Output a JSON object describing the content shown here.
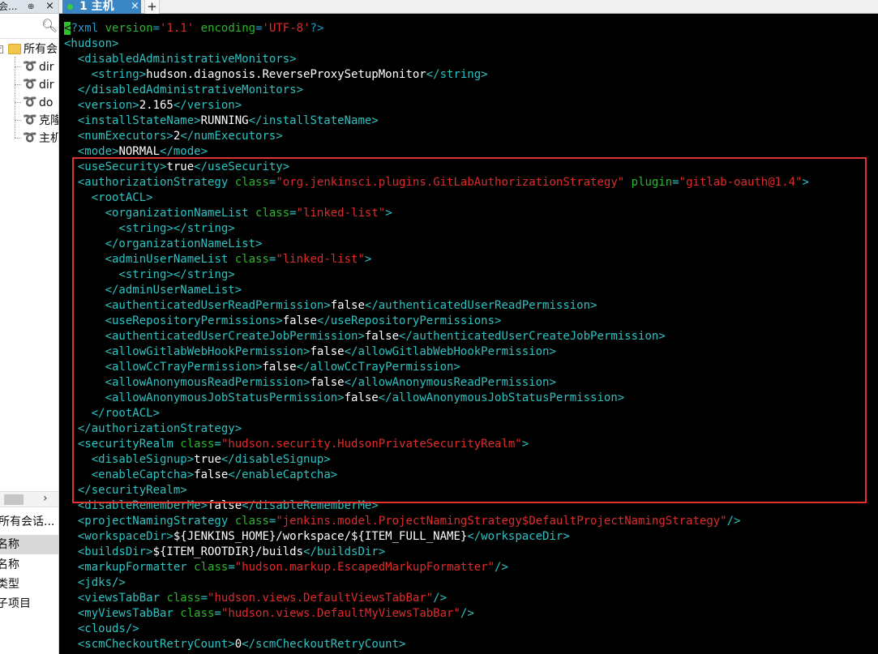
{
  "left_panel": {
    "title": "会...",
    "pin_glyph": "⊕",
    "close_glyph": "×",
    "root_label": "所有会",
    "sessions": [
      "dir",
      "dir",
      "do",
      "克隆",
      "主机"
    ],
    "props_title": "所有会话...",
    "props_header": "名称",
    "props_rows": [
      "名称",
      "类型",
      "子项目"
    ]
  },
  "tabs": {
    "active_label": "1 主机",
    "close_glyph": "×",
    "add_glyph": "+"
  },
  "terminal": {
    "lines": [
      [
        [
          "pistart",
          "<"
        ],
        [
          "pi",
          "?xml "
        ],
        [
          "at",
          "version"
        ],
        [
          "pi",
          "="
        ],
        [
          "av",
          "'1.1'"
        ],
        [
          "pi",
          " "
        ],
        [
          "at",
          "encoding"
        ],
        [
          "pi",
          "="
        ],
        [
          "av",
          "'UTF-8'"
        ],
        [
          "pi",
          "?>"
        ]
      ],
      [
        [
          "tg",
          "<hudson>"
        ]
      ],
      [
        [
          "tx",
          "  "
        ],
        [
          "tg",
          "<disabledAdministrativeMonitors>"
        ]
      ],
      [
        [
          "tx",
          "    "
        ],
        [
          "tg",
          "<string>"
        ],
        [
          "tx",
          "hudson.diagnosis.ReverseProxySetupMonitor"
        ],
        [
          "tg",
          "</string>"
        ]
      ],
      [
        [
          "tx",
          "  "
        ],
        [
          "tg",
          "</disabledAdministrativeMonitors>"
        ]
      ],
      [
        [
          "tx",
          "  "
        ],
        [
          "tg",
          "<version>"
        ],
        [
          "tx",
          "2.165"
        ],
        [
          "tg",
          "</version>"
        ]
      ],
      [
        [
          "tx",
          "  "
        ],
        [
          "tg",
          "<installStateName>"
        ],
        [
          "tx",
          "RUNNING"
        ],
        [
          "tg",
          "</installStateName>"
        ]
      ],
      [
        [
          "tx",
          "  "
        ],
        [
          "tg",
          "<numExecutors>"
        ],
        [
          "tx",
          "2"
        ],
        [
          "tg",
          "</numExecutors>"
        ]
      ],
      [
        [
          "tx",
          "  "
        ],
        [
          "tg",
          "<mode>"
        ],
        [
          "tx",
          "NORMAL"
        ],
        [
          "tg",
          "</mode>"
        ]
      ],
      [
        [
          "tx",
          "  "
        ],
        [
          "tg",
          "<useSecurity>"
        ],
        [
          "tx",
          "true"
        ],
        [
          "tg",
          "</useSecurity>"
        ]
      ],
      [
        [
          "tx",
          "  "
        ],
        [
          "tg",
          "<authorizationStrategy "
        ],
        [
          "at",
          "class"
        ],
        [
          "tg",
          "="
        ],
        [
          "av",
          "\"org.jenkinsci.plugins.GitLabAuthorizationStrategy\""
        ],
        [
          "tg",
          " "
        ],
        [
          "at",
          "plugin"
        ],
        [
          "tg",
          "="
        ],
        [
          "av",
          "\"gitlab-oauth@1.4\""
        ],
        [
          "tg",
          ">"
        ]
      ],
      [
        [
          "tx",
          "    "
        ],
        [
          "tg",
          "<rootACL>"
        ]
      ],
      [
        [
          "tx",
          "      "
        ],
        [
          "tg",
          "<organizationNameList "
        ],
        [
          "at",
          "class"
        ],
        [
          "tg",
          "="
        ],
        [
          "av",
          "\"linked-list\""
        ],
        [
          "tg",
          ">"
        ]
      ],
      [
        [
          "tx",
          "        "
        ],
        [
          "tg",
          "<string></string>"
        ]
      ],
      [
        [
          "tx",
          "      "
        ],
        [
          "tg",
          "</organizationNameList>"
        ]
      ],
      [
        [
          "tx",
          "      "
        ],
        [
          "tg",
          "<adminUserNameList "
        ],
        [
          "at",
          "class"
        ],
        [
          "tg",
          "="
        ],
        [
          "av",
          "\"linked-list\""
        ],
        [
          "tg",
          ">"
        ]
      ],
      [
        [
          "tx",
          "        "
        ],
        [
          "tg",
          "<string></string>"
        ]
      ],
      [
        [
          "tx",
          "      "
        ],
        [
          "tg",
          "</adminUserNameList>"
        ]
      ],
      [
        [
          "tx",
          "      "
        ],
        [
          "tg",
          "<authenticatedUserReadPermission>"
        ],
        [
          "tx",
          "false"
        ],
        [
          "tg",
          "</authenticatedUserReadPermission>"
        ]
      ],
      [
        [
          "tx",
          "      "
        ],
        [
          "tg",
          "<useRepositoryPermissions>"
        ],
        [
          "tx",
          "false"
        ],
        [
          "tg",
          "</useRepositoryPermissions>"
        ]
      ],
      [
        [
          "tx",
          "      "
        ],
        [
          "tg",
          "<authenticatedUserCreateJobPermission>"
        ],
        [
          "tx",
          "false"
        ],
        [
          "tg",
          "</authenticatedUserCreateJobPermission>"
        ]
      ],
      [
        [
          "tx",
          "      "
        ],
        [
          "tg",
          "<allowGitlabWebHookPermission>"
        ],
        [
          "tx",
          "false"
        ],
        [
          "tg",
          "</allowGitlabWebHookPermission>"
        ]
      ],
      [
        [
          "tx",
          "      "
        ],
        [
          "tg",
          "<allowCcTrayPermission>"
        ],
        [
          "tx",
          "false"
        ],
        [
          "tg",
          "</allowCcTrayPermission>"
        ]
      ],
      [
        [
          "tx",
          "      "
        ],
        [
          "tg",
          "<allowAnonymousReadPermission>"
        ],
        [
          "tx",
          "false"
        ],
        [
          "tg",
          "</allowAnonymousReadPermission>"
        ]
      ],
      [
        [
          "tx",
          "      "
        ],
        [
          "tg",
          "<allowAnonymousJobStatusPermission>"
        ],
        [
          "tx",
          "false"
        ],
        [
          "tg",
          "</allowAnonymousJobStatusPermission>"
        ]
      ],
      [
        [
          "tx",
          "    "
        ],
        [
          "tg",
          "</rootACL>"
        ]
      ],
      [
        [
          "tx",
          "  "
        ],
        [
          "tg",
          "</authorizationStrategy>"
        ]
      ],
      [
        [
          "tx",
          "  "
        ],
        [
          "tg",
          "<securityRealm "
        ],
        [
          "at",
          "class"
        ],
        [
          "tg",
          "="
        ],
        [
          "av",
          "\"hudson.security.HudsonPrivateSecurityRealm\""
        ],
        [
          "tg",
          ">"
        ]
      ],
      [
        [
          "tx",
          "    "
        ],
        [
          "tg",
          "<disableSignup>"
        ],
        [
          "tx",
          "true"
        ],
        [
          "tg",
          "</disableSignup>"
        ]
      ],
      [
        [
          "tx",
          "    "
        ],
        [
          "tg",
          "<enableCaptcha>"
        ],
        [
          "tx",
          "false"
        ],
        [
          "tg",
          "</enableCaptcha>"
        ]
      ],
      [
        [
          "tx",
          "  "
        ],
        [
          "tg",
          "</securityRealm>"
        ]
      ],
      [
        [
          "tx",
          "  "
        ],
        [
          "tg",
          "<disableRememberMe>"
        ],
        [
          "tx",
          "false"
        ],
        [
          "tg",
          "</disableRememberMe>"
        ]
      ],
      [
        [
          "tx",
          "  "
        ],
        [
          "tg",
          "<projectNamingStrategy "
        ],
        [
          "at",
          "class"
        ],
        [
          "tg",
          "="
        ],
        [
          "av",
          "\"jenkins.model.ProjectNamingStrategy$DefaultProjectNamingStrategy\""
        ],
        [
          "tg",
          "/>"
        ]
      ],
      [
        [
          "tx",
          "  "
        ],
        [
          "tg",
          "<workspaceDir>"
        ],
        [
          "tx",
          "${JENKINS_HOME}/workspace/${ITEM_FULL_NAME}"
        ],
        [
          "tg",
          "</workspaceDir>"
        ]
      ],
      [
        [
          "tx",
          "  "
        ],
        [
          "tg",
          "<buildsDir>"
        ],
        [
          "tx",
          "${ITEM_ROOTDIR}/builds"
        ],
        [
          "tg",
          "</buildsDir>"
        ]
      ],
      [
        [
          "tx",
          "  "
        ],
        [
          "tg",
          "<markupFormatter "
        ],
        [
          "at",
          "class"
        ],
        [
          "tg",
          "="
        ],
        [
          "av",
          "\"hudson.markup.EscapedMarkupFormatter\""
        ],
        [
          "tg",
          "/>"
        ]
      ],
      [
        [
          "tx",
          "  "
        ],
        [
          "tg",
          "<jdks/>"
        ]
      ],
      [
        [
          "tx",
          "  "
        ],
        [
          "tg",
          "<viewsTabBar "
        ],
        [
          "at",
          "class"
        ],
        [
          "tg",
          "="
        ],
        [
          "av",
          "\"hudson.views.DefaultViewsTabBar\""
        ],
        [
          "tg",
          "/>"
        ]
      ],
      [
        [
          "tx",
          "  "
        ],
        [
          "tg",
          "<myViewsTabBar "
        ],
        [
          "at",
          "class"
        ],
        [
          "tg",
          "="
        ],
        [
          "av",
          "\"hudson.views.DefaultMyViewsTabBar\""
        ],
        [
          "tg",
          "/>"
        ]
      ],
      [
        [
          "tx",
          "  "
        ],
        [
          "tg",
          "<clouds/>"
        ]
      ],
      [
        [
          "tx",
          "  "
        ],
        [
          "tg",
          "<scmCheckoutRetryCount>"
        ],
        [
          "tx",
          "0"
        ],
        [
          "tg",
          "</scmCheckoutRetryCount>"
        ]
      ]
    ]
  },
  "colors": {
    "tag": "#2ec2c2",
    "attribute": "#2db52d",
    "attribute_value": "#dd2c2c",
    "text": "#ffffff",
    "highlight_box": "#e0322f",
    "active_tab": "#3a86c4"
  }
}
